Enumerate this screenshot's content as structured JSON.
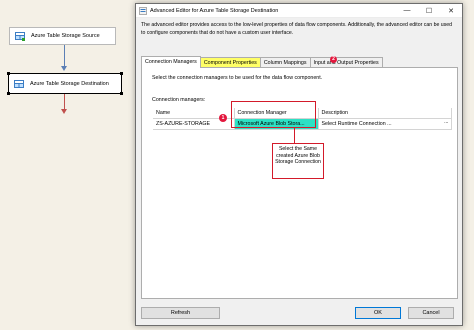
{
  "canvas": {
    "source_node_label": "Azure Table Storage Source",
    "destination_node_label": "Azure Table Storage Destination"
  },
  "dialog": {
    "title": "Advanced Editor for Azure Table Storage Destination",
    "window_buttons": {
      "minimize": "—",
      "maximize": "☐",
      "close": "✕"
    },
    "description": "The advanced editor provides access to the low-level properties of data flow components. Additionally, the advanced editor can be used to configure components that do not have a custom user interface.",
    "tabs": [
      {
        "label": "Connection Managers"
      },
      {
        "label": "Component Properties"
      },
      {
        "label": "Column Mappings"
      },
      {
        "label": "Input and Output Properties"
      }
    ],
    "panel": {
      "instruction": "Select the connection managers to be used for the data flow component.",
      "connection_managers_label": "Connection managers:",
      "grid": {
        "columns": [
          "Name",
          "Connection Manager",
          "Description"
        ],
        "rows": [
          {
            "name": "ZS-AZURE-STORAGE",
            "connection_manager": "Microsoft Azure Blob Stora...",
            "description": "Select Runtime Connection ..."
          }
        ],
        "ellipsis": "..."
      }
    },
    "annotations": {
      "tab_marker": "2",
      "cell_marker": "1",
      "callout_text": "Select the Same created Azure Blob Storage Connection"
    },
    "buttons": {
      "refresh": "Refresh",
      "ok": "OK",
      "cancel": "Cancel"
    }
  },
  "colors": {
    "highlight_tab": "#ffff66",
    "selected_cell": "#2ee0c4",
    "annotation_red": "#d31a2a",
    "marker_red": "#e3173d"
  }
}
